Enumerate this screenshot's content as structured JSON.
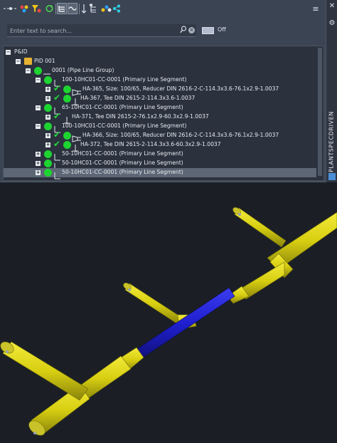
{
  "toolbar": {
    "icons": [
      "line-group-icon",
      "color-dots-icon",
      "filter-icon",
      "refresh-icon",
      "tree-view-icon",
      "line-view-icon",
      "sort-icon",
      "hierarchy-icon",
      "color-scheme-icon",
      "share-icon"
    ],
    "menu_glyph": "≡"
  },
  "side": {
    "close_glyph": "✕",
    "settings_glyph": "⚙",
    "tab_label": "PLANTSPECDRIVEN"
  },
  "search": {
    "placeholder": "Enter text to search...",
    "value": "",
    "toggle_label": "Off"
  },
  "tree": {
    "rows": [
      {
        "label": "P&ID"
      },
      {
        "label": "PID 001"
      },
      {
        "label": "0001 (Pipe Line Group)"
      },
      {
        "label": "100-10HC01-CC-0001 (Primary Line Segment)"
      },
      {
        "label": "HA-365, Size: 100/65, Reducer DIN 2616-2-C-114.3x3.6-76.1x2.9-1.0037"
      },
      {
        "label": "HA-367, Tee DIN 2615-2-114.3x3.6-1.0037"
      },
      {
        "label": "65-10HC01-CC-0001 (Primary Line Segment)"
      },
      {
        "label": "HA-371, Tee DIN 2615-2-76.1x2.9-60.3x2.9-1.0037"
      },
      {
        "label": "100-10HC01-CC-0001 (Primary Line Segment)"
      },
      {
        "label": "HA-366, Size: 100/65, Reducer DIN 2616-2-C-114.3x3.6-76.1x2.9-1.0037"
      },
      {
        "label": "HA-372, Tee DIN 2615-2-114.3x3.6-60.3x2.9-1.0037"
      },
      {
        "label": "50-10HC01-CC-0001 (Primary Line Segment)"
      },
      {
        "label": "50-10HC01-CC-0001 (Primary Line Segment)"
      },
      {
        "label": "50-10HC01-CC-0001 (Primary Line Segment)"
      }
    ]
  },
  "colors": {
    "pipe": "#d8cf12",
    "highlight": "#1f1fd0",
    "panel": "#3b4453",
    "tree_bg": "#2b323e",
    "status_green": "#1ed430"
  }
}
